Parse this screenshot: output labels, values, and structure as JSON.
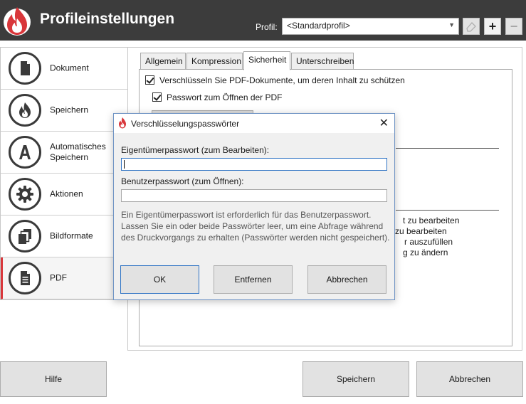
{
  "header": {
    "title": "Profileinstellungen",
    "profile_label": "Profil:",
    "profile_value": "<Standardprofil>",
    "add_symbol": "+",
    "remove_symbol": "−"
  },
  "colors": {
    "header_bg": "#3c3c3c",
    "accent_red": "#d9373b",
    "dialog_border": "#6e93c4"
  },
  "sidebar": {
    "items": [
      {
        "label": "Dokument",
        "icon": "document-icon"
      },
      {
        "label": "Speichern",
        "icon": "flame-icon"
      },
      {
        "label": "Automatisches Speichern",
        "icon": "letter-a-icon"
      },
      {
        "label": "Aktionen",
        "icon": "gear-icon"
      },
      {
        "label": "Bildformate",
        "icon": "stacked-pages-icon"
      },
      {
        "label": "PDF",
        "icon": "pdf-document-icon",
        "active": true
      }
    ]
  },
  "tabs": [
    {
      "label": "Allgemein"
    },
    {
      "label": "Kompression"
    },
    {
      "label": "Sicherheit",
      "active": true
    },
    {
      "label": "Unterschreiben"
    }
  ],
  "security": {
    "encrypt_label": "Verschlüsseln Sie PDF-Dokumente, um deren Inhalt zu schützen",
    "open_password_label": "Passwort zum Öffnen der PDF",
    "permissions_partial": [
      "t zu bearbeiten",
      "zu bearbeiten",
      "r auszufüllen",
      "g zu ändern"
    ]
  },
  "footer": {
    "help": "Hilfe",
    "save": "Speichern",
    "cancel": "Abbrechen"
  },
  "dialog": {
    "title": "Verschlüsselungspasswörter",
    "close_symbol": "✕",
    "owner_label": "Eigentümerpasswort (zum Bearbeiten):",
    "owner_value": "",
    "user_label": "Benutzerpasswort (zum Öffnen):",
    "user_value": "",
    "info_line1": "Ein Eigentümerpasswort ist erforderlich für das Benutzerpasswort.",
    "info_line2": "Lassen Sie ein oder beide Passwörter leer, um eine Abfrage während",
    "info_line3": "des Druckvorgangs zu erhalten (Passwörter werden nicht gespeichert).",
    "ok": "OK",
    "remove": "Entfernen",
    "cancel": "Abbrechen"
  }
}
